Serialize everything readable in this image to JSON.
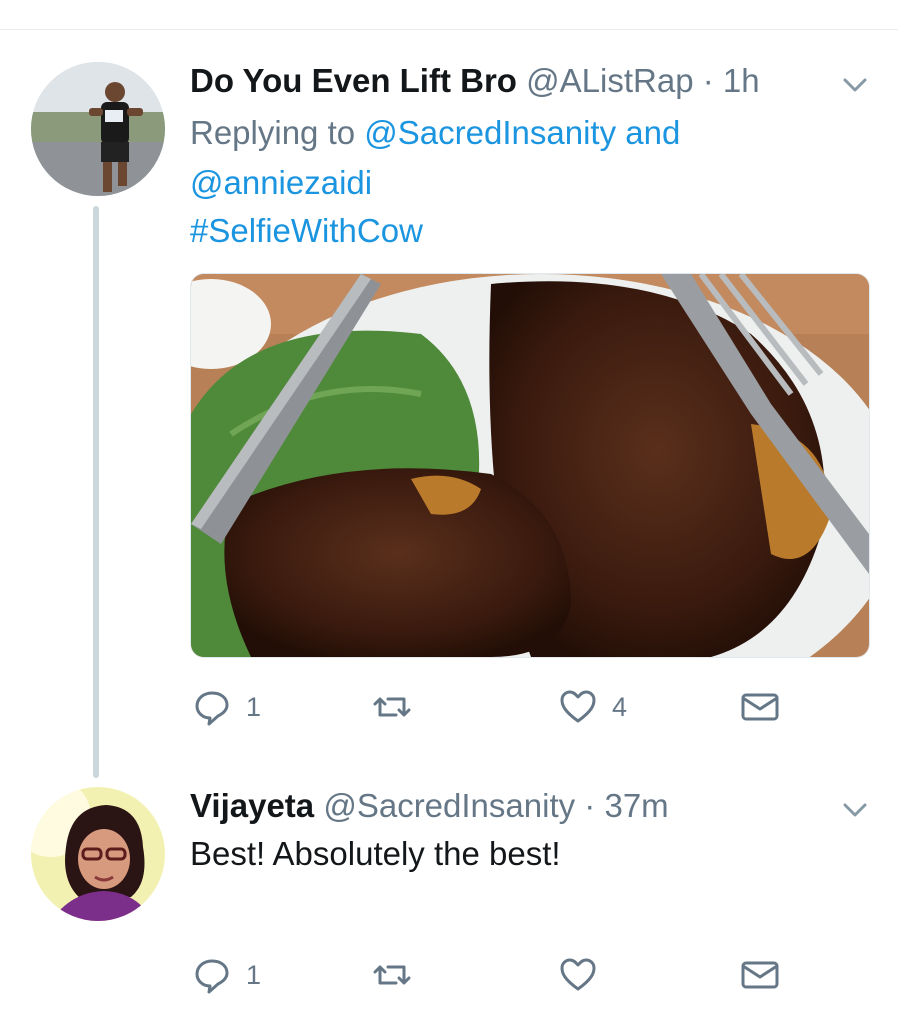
{
  "colors": {
    "accent": "#1b95e0",
    "secondary_text": "#657786",
    "primary_text": "#14171a",
    "thread_line": "#ccd6dd"
  },
  "tweets": [
    {
      "name": "Do You Even Lift Bro",
      "handle": "@AListRap",
      "separator": "·",
      "time": "1h",
      "replying_prefix": "Replying to",
      "replying_users": [
        "@SacredInsanity",
        "@anniezaidi"
      ],
      "replying_joiner": "and",
      "hashtag": "#SelfieWithCow",
      "media": "grilled-steak-photo",
      "actions": {
        "reply_count": "1",
        "retweet_count": "",
        "like_count": "4"
      },
      "icons": [
        "reply-icon",
        "retweet-icon",
        "like-icon",
        "message-icon",
        "chevron-down-icon"
      ]
    },
    {
      "name": "Vijayeta",
      "handle": "@SacredInsanity",
      "separator": "·",
      "time": "37m",
      "text": "Best! Absolutely the best!",
      "actions": {
        "reply_count": "1",
        "retweet_count": "",
        "like_count": ""
      },
      "icons": [
        "reply-icon",
        "retweet-icon",
        "like-icon",
        "message-icon",
        "chevron-down-icon"
      ]
    }
  ]
}
